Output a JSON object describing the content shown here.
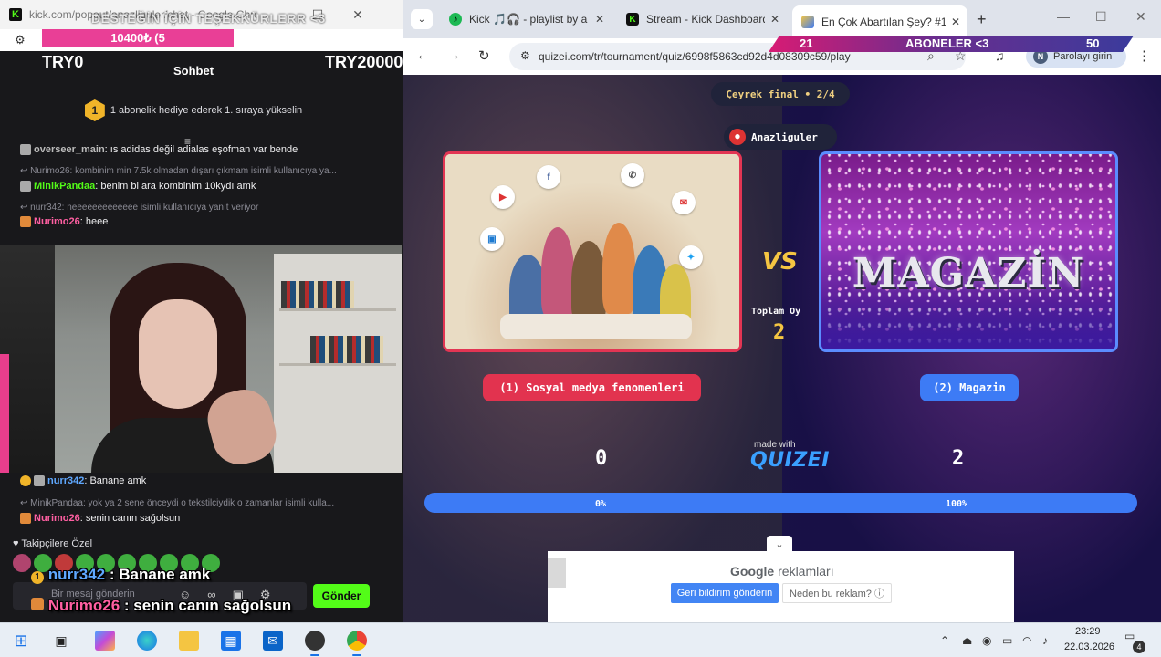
{
  "popout": {
    "url": "kick.com/popout/anazliguler/chat - Google Chro...",
    "overlay_text": "DESTEĞİN İÇİN TEŞEKKÜRLERR <3",
    "donation_bar": "10400₺ (5",
    "try_left": "TRY0",
    "try_right": "TRY20000",
    "chat_title": "Sohbet",
    "gift_badge": "1",
    "gift_text": "1 abonelik hediye ederek 1. sıraya yükselin",
    "messages": [
      {
        "user": "overseer_main",
        "text": ": ıs adidas değil adialas eşofman var bende"
      },
      {
        "reply": "Nurimo26: kombinim min 7.5k olmadan dışarı çıkmam isimli kullanıcıya ya..."
      },
      {
        "user": "MinikPandaa",
        "text": ": benim bi ara kombinim 10kydı amk"
      },
      {
        "reply": "nurr342: neeeeeeeeeeeee isimli kullanıcıya yanıt veriyor"
      },
      {
        "user": "Nurimo26",
        "text": ": heee"
      }
    ],
    "bottom_messages": [
      {
        "badge": "1",
        "user": "nurr342",
        "text": ": Banane amk"
      },
      {
        "reply": "MinikPandaa: yok ya 2 sene önceydi o tekstilciydik o zamanlar isimli kulla..."
      },
      {
        "user": "Nurimo26",
        "text": ": senin canın sağolsun"
      }
    ],
    "followers_label": "Takipçilere Özel",
    "input_placeholder": "Bir mesaj gönderin",
    "send_label": "Gönder",
    "overlay_msg1_badge": "1",
    "overlay_msg1_user": "nurr342",
    "overlay_msg1_text": " : Banane amk",
    "overlay_msg2_user": "Nurimo26",
    "overlay_msg2_text": " : senin canın sağolsun"
  },
  "chrome": {
    "tabs": [
      {
        "label": "Kick 🎵🎧 - playlist by a...",
        "active": false
      },
      {
        "label": "Stream - Kick Dashboard",
        "active": false
      },
      {
        "label": "En Çok Abartılan Şey? #1",
        "active": true
      }
    ],
    "sub_overlay": {
      "left": "21",
      "mid": "ABONELER <3",
      "right": "50"
    },
    "url": "quizei.com/tr/tournament/quiz/6998f5863cd92d4d08309c59/play",
    "profile_initial": "N",
    "profile_label": "Parolayı girin"
  },
  "quiz": {
    "round": "Çeyrek final • 2/4",
    "author": "Anazliguler",
    "option_left": "(1) Sosyal medya fenomenleri",
    "option_right": "(2) Magazin",
    "magazin_art": "MAGAZİN",
    "vs": "VS",
    "total_label": "Toplam Oy",
    "total_value": "2",
    "made_with": "made with",
    "logo": "QUIZEI",
    "score_left": "0",
    "score_right": "2",
    "pct_left": "0%",
    "pct_right": "100%",
    "progress_left_fraction": 0.0,
    "colors": {
      "left": "#e2334f",
      "right": "#3d7bf5",
      "accent": "#f4c542"
    }
  },
  "ad": {
    "brand": "Google",
    "title": "reklamları",
    "feedback": "Geri bildirim gönderin",
    "why": "Neden bu reklam? ⓘ"
  },
  "taskbar": {
    "time": "23:29",
    "date": "22.03.2026",
    "notif_count": "4"
  }
}
